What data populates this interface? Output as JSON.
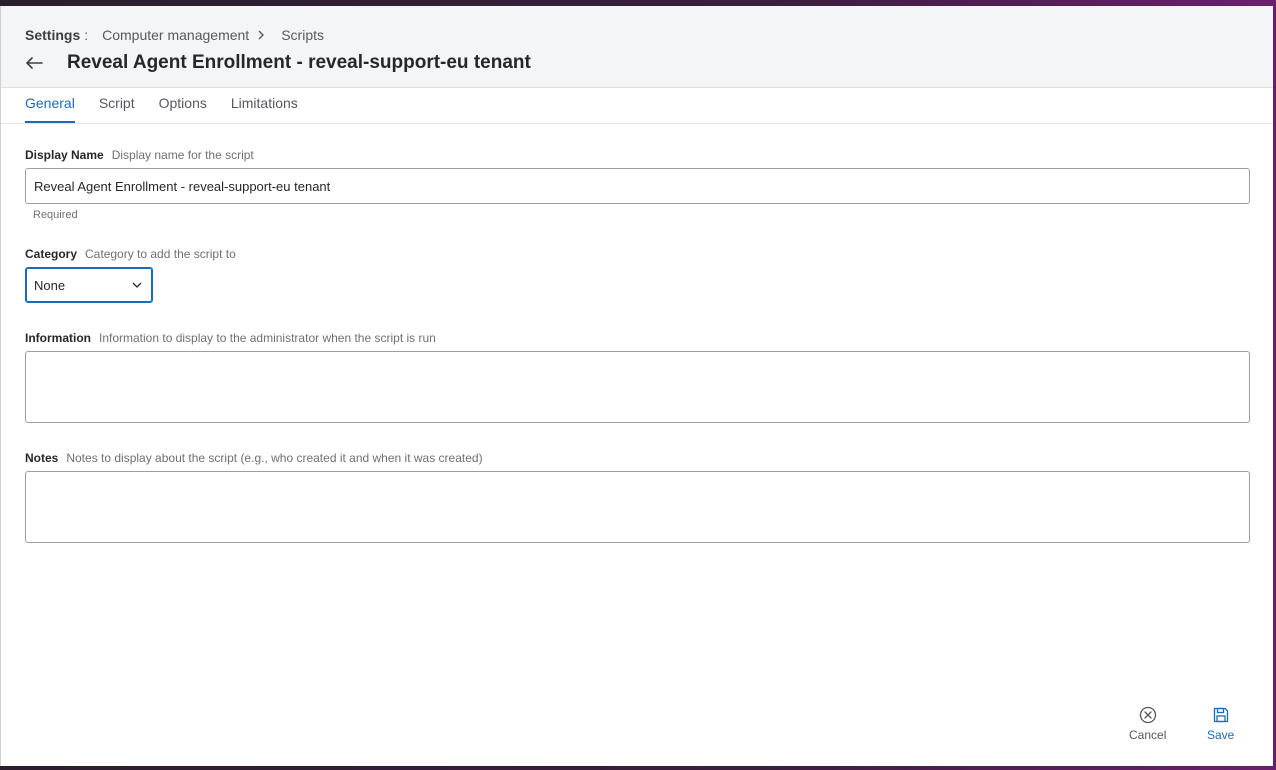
{
  "breadcrumb": {
    "root": "Settings",
    "separator": ":",
    "items": [
      "Computer management",
      "Scripts"
    ]
  },
  "header": {
    "title": "Reveal Agent Enrollment - reveal-support-eu tenant"
  },
  "tabs": [
    {
      "label": "General",
      "active": true
    },
    {
      "label": "Script",
      "active": false
    },
    {
      "label": "Options",
      "active": false
    },
    {
      "label": "Limitations",
      "active": false
    }
  ],
  "form": {
    "display_name": {
      "label": "Display Name",
      "hint": "Display name for the script",
      "value": "Reveal Agent Enrollment - reveal-support-eu tenant",
      "helper": "Required"
    },
    "category": {
      "label": "Category",
      "hint": "Category to add the script to",
      "selected": "None"
    },
    "information": {
      "label": "Information",
      "hint": "Information to display to the administrator when the script is run",
      "value": ""
    },
    "notes": {
      "label": "Notes",
      "hint": "Notes to display about the script (e.g., who created it and when it was created)",
      "value": ""
    }
  },
  "footer": {
    "cancel_label": "Cancel",
    "save_label": "Save"
  },
  "colors": {
    "accent": "#1c6bba",
    "header_bg": "#f4f5f7"
  },
  "icons": {
    "back": "arrow-left-icon",
    "chevron": "chevron-right-icon",
    "select": "chevron-down-icon",
    "cancel": "close-circle-icon",
    "save": "floppy-disk-icon"
  }
}
